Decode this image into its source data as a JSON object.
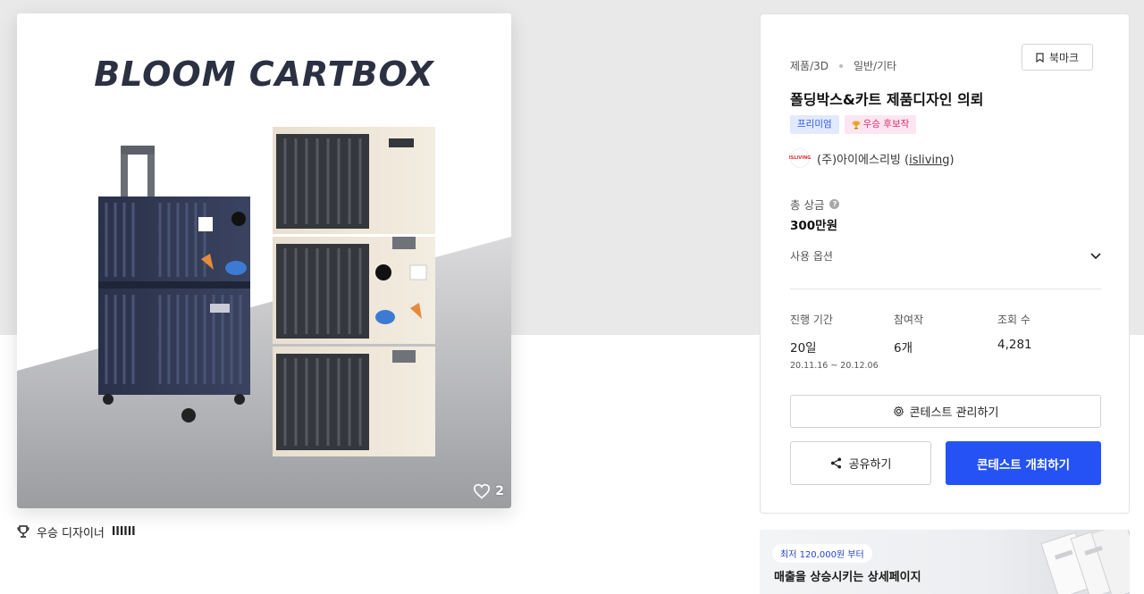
{
  "product_image": {
    "title": "BLOOM CARTBOX",
    "like_count": "2"
  },
  "winner": {
    "label": "우승 디자이너",
    "name": "llllll"
  },
  "contest": {
    "category": "제품/3D",
    "subcategory": "일반/기타",
    "bookmark_label": "북마크",
    "title": "폴딩박스&카트 제품디자인 의뢰",
    "badges": [
      "프리미엄",
      "우승 후보작"
    ],
    "host_name": "(주)아이에스리빙",
    "host_id_open": " (",
    "host_id": "isliving",
    "host_id_close": ")",
    "prize_label": "총 상금",
    "prize_value": "300만원",
    "usage_label": "사용 옵션",
    "stats": {
      "period_label": "진행 기간",
      "period_value": "20일",
      "period_dates": "20.11.16  ~  20.12.06",
      "participants_label": "참여작",
      "participants_value": "6개",
      "views_label": "조회 수",
      "views_value": "4,281"
    },
    "manage_label": "콘테스트 관리하기",
    "share_label": "공유하기",
    "host_button_label": "콘테스트 개최하기"
  },
  "ad": {
    "pill": "최저 120,000원 부터",
    "text": "매출을 상승시키는 상세페이지"
  },
  "colors": {
    "primary": "#2552f4",
    "premium_badge_bg": "#e2eaff",
    "award_badge_bg": "#fde6f1",
    "navy_box": "#2f3850",
    "cream_box": "#efe7da"
  }
}
